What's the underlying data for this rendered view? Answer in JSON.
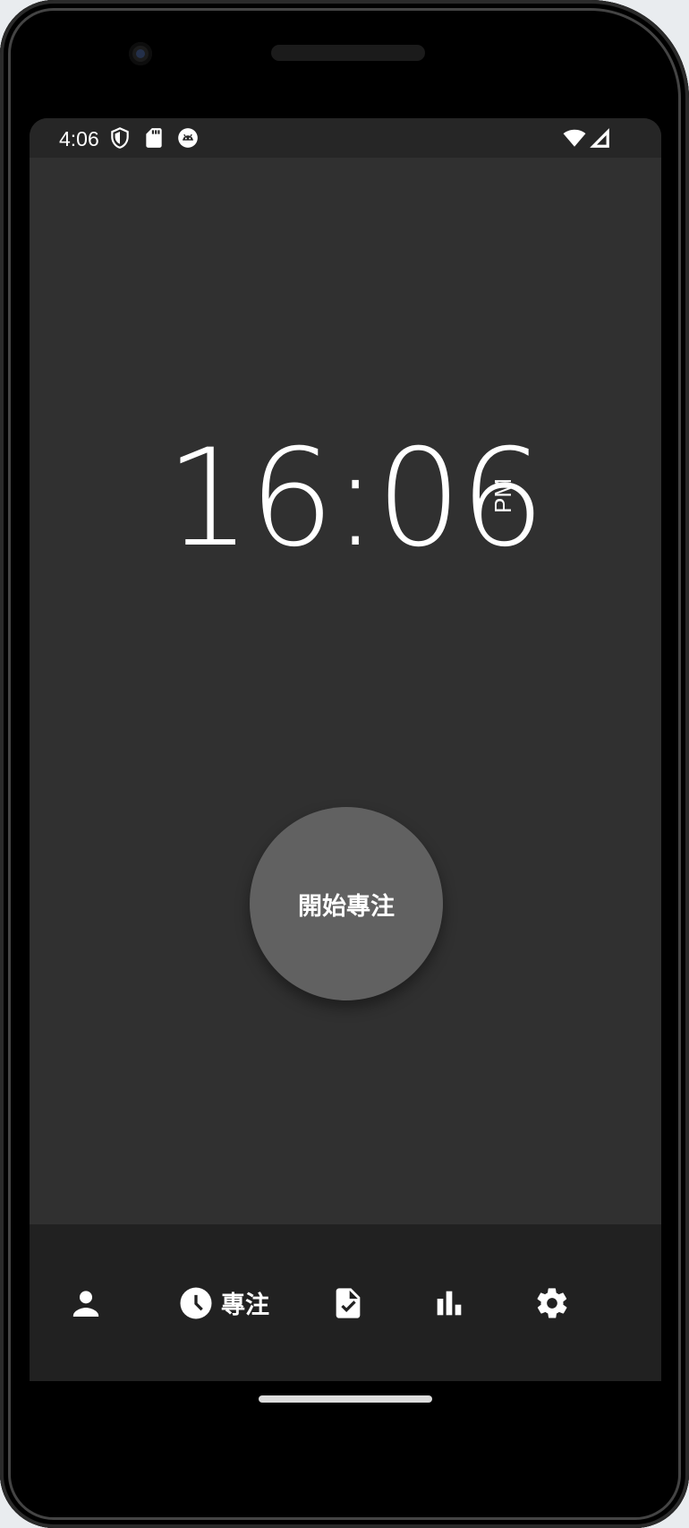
{
  "status_bar": {
    "time": "4:06",
    "left_icons": [
      "shield-icon",
      "sd-card-icon",
      "android-debug-icon"
    ],
    "right_icons": [
      "wifi-icon",
      "cellular-signal-icon"
    ]
  },
  "clock": {
    "time": "16:06",
    "ampm": "PM"
  },
  "start_button": {
    "label": "開始專注"
  },
  "bottom_nav": {
    "items": [
      {
        "icon": "person-icon",
        "label": ""
      },
      {
        "icon": "clock-icon",
        "label": "專注",
        "selected": true
      },
      {
        "icon": "task-check-icon",
        "label": ""
      },
      {
        "icon": "bar-chart-icon",
        "label": ""
      },
      {
        "icon": "gear-icon",
        "label": ""
      }
    ]
  },
  "colors": {
    "screen_bg": "#303030",
    "status_bar_bg": "#262626",
    "nav_bg": "#212121",
    "button_bg": "#616161",
    "text": "#ffffff"
  }
}
